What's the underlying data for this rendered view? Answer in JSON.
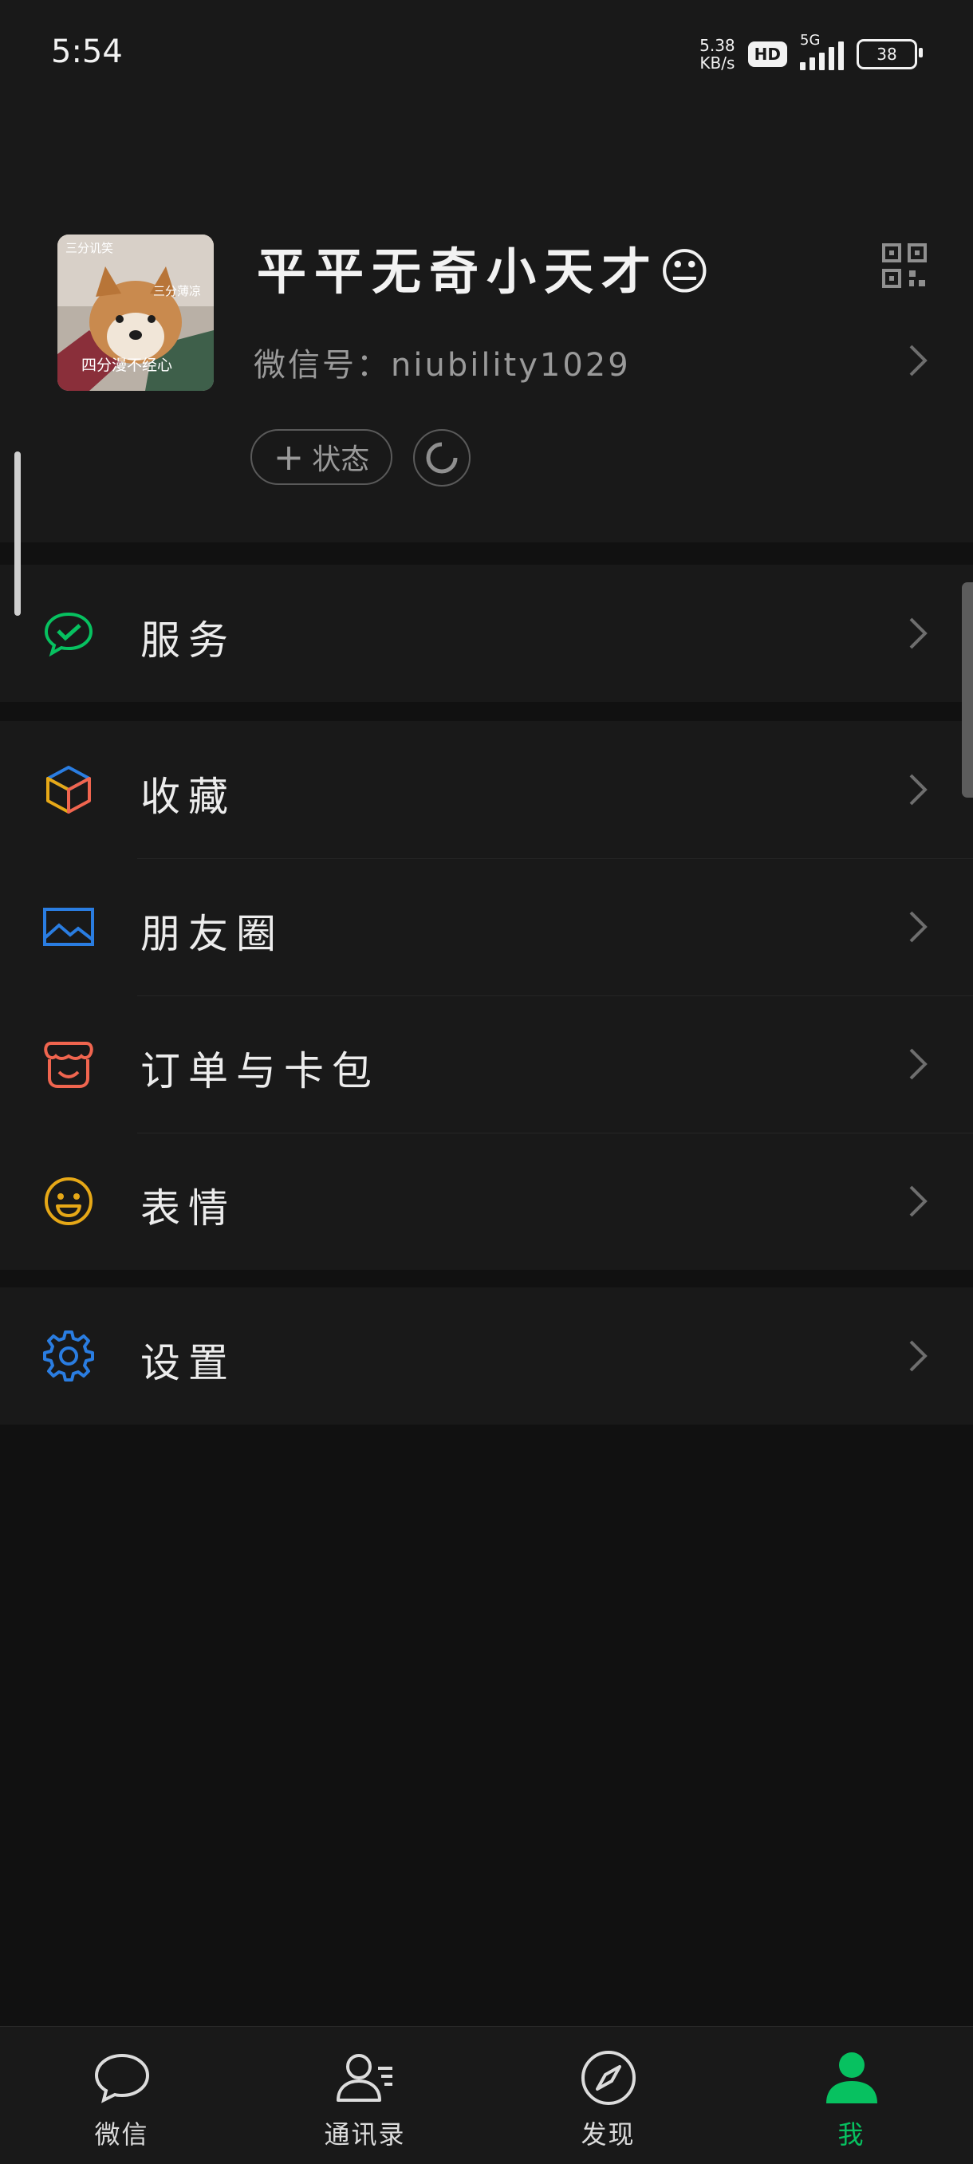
{
  "status_bar": {
    "time": "5:54",
    "net_speed_value": "5.38",
    "net_speed_unit": "KB/s",
    "hd": "HD",
    "network": "5G",
    "battery": "38"
  },
  "profile": {
    "avatar_caption_top": "三分讥笑",
    "avatar_caption_mid": "三分薄凉",
    "avatar_caption_bottom": "四分漫不经心",
    "nickname": "平平无奇小天才😐",
    "wechat_id": "微信号：niubility1029",
    "status_button": "状态",
    "status_plus": "+"
  },
  "menu": {
    "services": {
      "label": "服务",
      "icon": "wechat-pay-check-icon",
      "color": "#07c160"
    },
    "favorites": {
      "label": "收藏",
      "icon": "cube-icon"
    },
    "moments": {
      "label": "朋友圈",
      "icon": "picture-icon",
      "color": "#2a7de1"
    },
    "orders": {
      "label": "订单与卡包",
      "icon": "wallet-icon",
      "color": "#f0654f"
    },
    "stickers": {
      "label": "表情",
      "icon": "smiley-icon",
      "color": "#e6a817"
    },
    "settings": {
      "label": "设置",
      "icon": "gear-icon",
      "color": "#2a7de1"
    }
  },
  "tabbar": {
    "chats": "微信",
    "contacts": "通讯录",
    "discover": "发现",
    "me": "我",
    "active_color": "#07c160"
  }
}
